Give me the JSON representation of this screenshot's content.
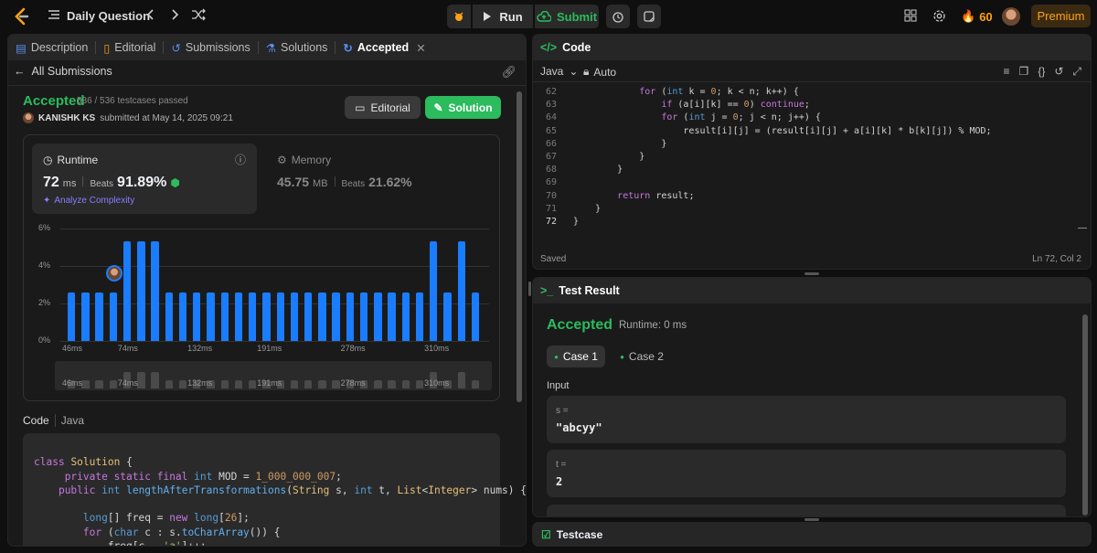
{
  "topbar": {
    "title": "Daily Question",
    "run": "Run",
    "submit": "Submit",
    "streak": "60",
    "premium": "Premium"
  },
  "left_tabs": {
    "description": "Description",
    "editorial": "Editorial",
    "submissions": "Submissions",
    "solutions": "Solutions",
    "accepted": "Accepted"
  },
  "sub": {
    "back": "All Submissions",
    "status": "Accepted",
    "testcases": "536 / 536 testcases passed",
    "user": "KANISHK KS",
    "submitted": "submitted at May 14, 2025 09:21",
    "editorial_btn": "Editorial",
    "solution_btn": "Solution"
  },
  "runtime": {
    "label": "Runtime",
    "value": "72",
    "unit": "ms",
    "beats_label": "Beats",
    "beats": "91.89%",
    "analyze": "Analyze Complexity"
  },
  "memory": {
    "label": "Memory",
    "value": "45.75",
    "unit": "MB",
    "beats_label": "Beats",
    "beats": "21.62%"
  },
  "chart_data": {
    "type": "bar",
    "y_ticks": [
      "6%",
      "4%",
      "2%",
      "0%"
    ],
    "x_ticks": [
      "46ms",
      "74ms",
      "132ms",
      "191ms",
      "278ms",
      "310ms"
    ],
    "values": [
      2.6,
      2.6,
      2.6,
      2.6,
      5.3,
      5.3,
      5.3,
      2.6,
      2.6,
      2.6,
      2.6,
      2.6,
      2.6,
      2.6,
      2.6,
      2.6,
      2.6,
      2.6,
      2.6,
      2.6,
      2.6,
      2.6,
      2.6,
      2.6,
      2.6,
      2.6,
      5.3,
      2.6,
      5.3,
      2.6
    ],
    "ylim": [
      0,
      6
    ],
    "mini_values": [
      1.2,
      1.2,
      1.2,
      1.2,
      2.4,
      2.4,
      2.4,
      1.2,
      1.2,
      1.2,
      1.2,
      1.2,
      1.2,
      1.2,
      1.2,
      1.2,
      1.2,
      1.2,
      1.2,
      1.2,
      1.2,
      1.2,
      1.2,
      1.2,
      1.2,
      1.2,
      2.4,
      1.2,
      2.4,
      1.2
    ]
  },
  "code_section": {
    "label": "Code",
    "lang": "Java"
  },
  "code_lines": [
    "class Solution {",
    "    private static final int MOD = 1_000_000_007;",
    "    public int lengthAfterTransformations(String s, int t, List<Integer> nums) {",
    "",
    "        long[] freq = new long[26];",
    "        for (char c : s.toCharArray()) {",
    "            freq[c - 'a']++;",
    "        }"
  ],
  "editor": {
    "title": "Code",
    "lang": "Java",
    "mode": "Auto",
    "saved": "Saved",
    "position": "Ln 72, Col 2",
    "line_numbers": [
      "62",
      "63",
      "64",
      "65",
      "66",
      "67",
      "68",
      "69",
      "70",
      "71",
      "72"
    ],
    "lines": [
      "            for (int k = 0; k < n; k++) {",
      "                if (a[i][k] == 0) continue;",
      "                for (int j = 0; j < n; j++) {",
      "                    result[i][j] = (result[i][j] + a[i][k] * b[k][j]) % MOD;",
      "                }",
      "            }",
      "        }",
      "",
      "        return result;",
      "    }",
      "}"
    ]
  },
  "test": {
    "title": "Test Result",
    "status": "Accepted",
    "runtime": "Runtime: 0 ms",
    "case1": "Case 1",
    "case2": "Case 2",
    "input_label": "Input",
    "s_label": "s =",
    "s_value": "\"abcyy\"",
    "t_label": "t =",
    "t_value": "2",
    "testcase": "Testcase"
  }
}
